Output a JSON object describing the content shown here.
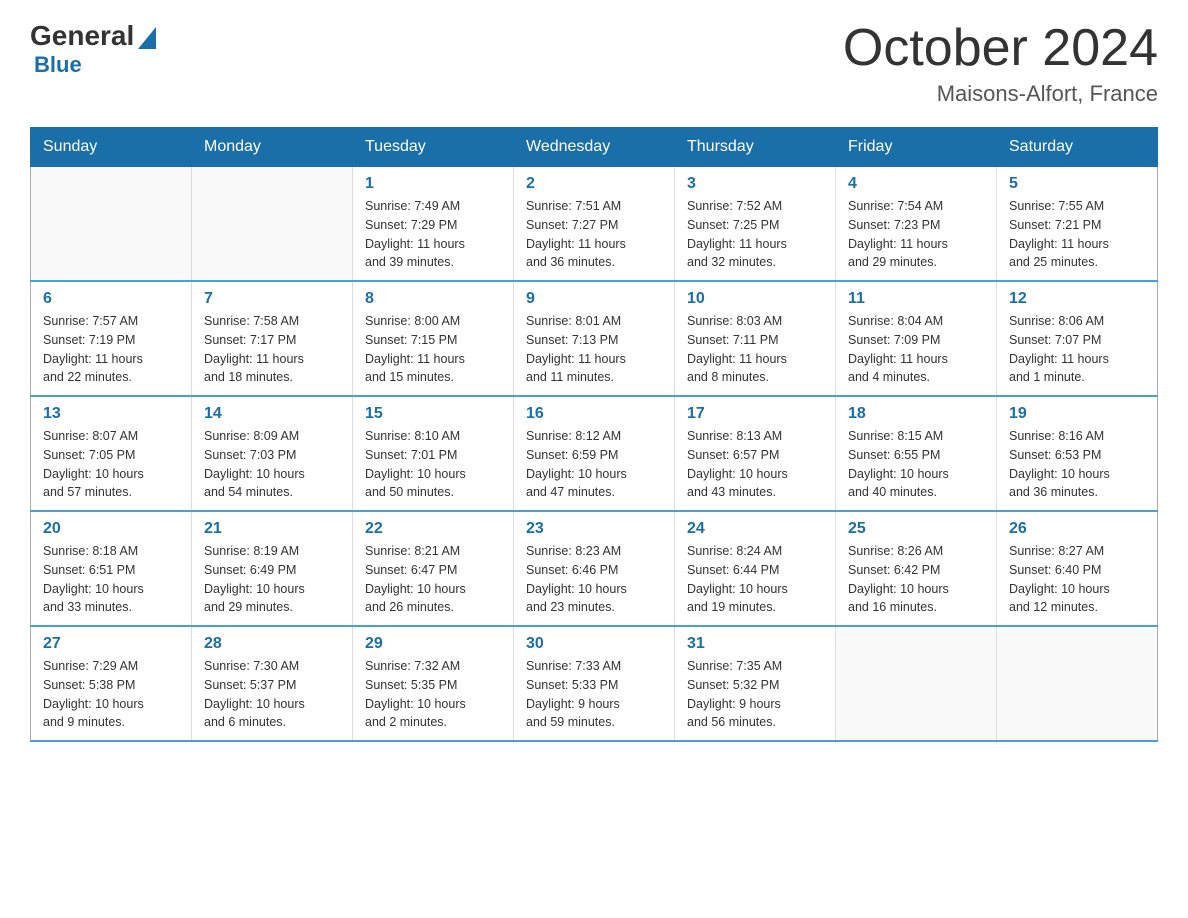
{
  "logo": {
    "general": "General",
    "blue": "Blue"
  },
  "title": "October 2024",
  "subtitle": "Maisons-Alfort, France",
  "weekdays": [
    "Sunday",
    "Monday",
    "Tuesday",
    "Wednesday",
    "Thursday",
    "Friday",
    "Saturday"
  ],
  "weeks": [
    [
      {
        "day": "",
        "info": ""
      },
      {
        "day": "",
        "info": ""
      },
      {
        "day": "1",
        "info": "Sunrise: 7:49 AM\nSunset: 7:29 PM\nDaylight: 11 hours\nand 39 minutes."
      },
      {
        "day": "2",
        "info": "Sunrise: 7:51 AM\nSunset: 7:27 PM\nDaylight: 11 hours\nand 36 minutes."
      },
      {
        "day": "3",
        "info": "Sunrise: 7:52 AM\nSunset: 7:25 PM\nDaylight: 11 hours\nand 32 minutes."
      },
      {
        "day": "4",
        "info": "Sunrise: 7:54 AM\nSunset: 7:23 PM\nDaylight: 11 hours\nand 29 minutes."
      },
      {
        "day": "5",
        "info": "Sunrise: 7:55 AM\nSunset: 7:21 PM\nDaylight: 11 hours\nand 25 minutes."
      }
    ],
    [
      {
        "day": "6",
        "info": "Sunrise: 7:57 AM\nSunset: 7:19 PM\nDaylight: 11 hours\nand 22 minutes."
      },
      {
        "day": "7",
        "info": "Sunrise: 7:58 AM\nSunset: 7:17 PM\nDaylight: 11 hours\nand 18 minutes."
      },
      {
        "day": "8",
        "info": "Sunrise: 8:00 AM\nSunset: 7:15 PM\nDaylight: 11 hours\nand 15 minutes."
      },
      {
        "day": "9",
        "info": "Sunrise: 8:01 AM\nSunset: 7:13 PM\nDaylight: 11 hours\nand 11 minutes."
      },
      {
        "day": "10",
        "info": "Sunrise: 8:03 AM\nSunset: 7:11 PM\nDaylight: 11 hours\nand 8 minutes."
      },
      {
        "day": "11",
        "info": "Sunrise: 8:04 AM\nSunset: 7:09 PM\nDaylight: 11 hours\nand 4 minutes."
      },
      {
        "day": "12",
        "info": "Sunrise: 8:06 AM\nSunset: 7:07 PM\nDaylight: 11 hours\nand 1 minute."
      }
    ],
    [
      {
        "day": "13",
        "info": "Sunrise: 8:07 AM\nSunset: 7:05 PM\nDaylight: 10 hours\nand 57 minutes."
      },
      {
        "day": "14",
        "info": "Sunrise: 8:09 AM\nSunset: 7:03 PM\nDaylight: 10 hours\nand 54 minutes."
      },
      {
        "day": "15",
        "info": "Sunrise: 8:10 AM\nSunset: 7:01 PM\nDaylight: 10 hours\nand 50 minutes."
      },
      {
        "day": "16",
        "info": "Sunrise: 8:12 AM\nSunset: 6:59 PM\nDaylight: 10 hours\nand 47 minutes."
      },
      {
        "day": "17",
        "info": "Sunrise: 8:13 AM\nSunset: 6:57 PM\nDaylight: 10 hours\nand 43 minutes."
      },
      {
        "day": "18",
        "info": "Sunrise: 8:15 AM\nSunset: 6:55 PM\nDaylight: 10 hours\nand 40 minutes."
      },
      {
        "day": "19",
        "info": "Sunrise: 8:16 AM\nSunset: 6:53 PM\nDaylight: 10 hours\nand 36 minutes."
      }
    ],
    [
      {
        "day": "20",
        "info": "Sunrise: 8:18 AM\nSunset: 6:51 PM\nDaylight: 10 hours\nand 33 minutes."
      },
      {
        "day": "21",
        "info": "Sunrise: 8:19 AM\nSunset: 6:49 PM\nDaylight: 10 hours\nand 29 minutes."
      },
      {
        "day": "22",
        "info": "Sunrise: 8:21 AM\nSunset: 6:47 PM\nDaylight: 10 hours\nand 26 minutes."
      },
      {
        "day": "23",
        "info": "Sunrise: 8:23 AM\nSunset: 6:46 PM\nDaylight: 10 hours\nand 23 minutes."
      },
      {
        "day": "24",
        "info": "Sunrise: 8:24 AM\nSunset: 6:44 PM\nDaylight: 10 hours\nand 19 minutes."
      },
      {
        "day": "25",
        "info": "Sunrise: 8:26 AM\nSunset: 6:42 PM\nDaylight: 10 hours\nand 16 minutes."
      },
      {
        "day": "26",
        "info": "Sunrise: 8:27 AM\nSunset: 6:40 PM\nDaylight: 10 hours\nand 12 minutes."
      }
    ],
    [
      {
        "day": "27",
        "info": "Sunrise: 7:29 AM\nSunset: 5:38 PM\nDaylight: 10 hours\nand 9 minutes."
      },
      {
        "day": "28",
        "info": "Sunrise: 7:30 AM\nSunset: 5:37 PM\nDaylight: 10 hours\nand 6 minutes."
      },
      {
        "day": "29",
        "info": "Sunrise: 7:32 AM\nSunset: 5:35 PM\nDaylight: 10 hours\nand 2 minutes."
      },
      {
        "day": "30",
        "info": "Sunrise: 7:33 AM\nSunset: 5:33 PM\nDaylight: 9 hours\nand 59 minutes."
      },
      {
        "day": "31",
        "info": "Sunrise: 7:35 AM\nSunset: 5:32 PM\nDaylight: 9 hours\nand 56 minutes."
      },
      {
        "day": "",
        "info": ""
      },
      {
        "day": "",
        "info": ""
      }
    ]
  ]
}
